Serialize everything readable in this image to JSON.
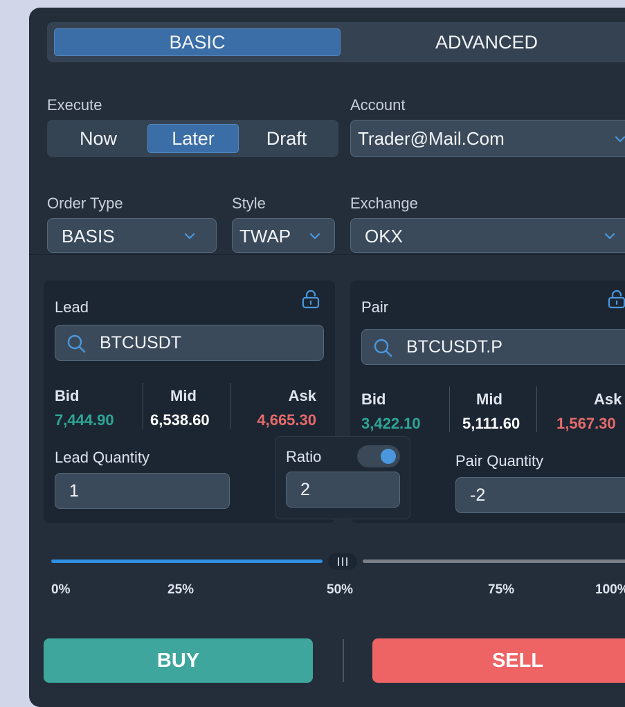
{
  "mode_tabs": {
    "basic": "BASIC",
    "advanced": "ADVANCED",
    "active": "BASIC"
  },
  "execute": {
    "label": "Execute",
    "options": [
      "Now",
      "Later",
      "Draft"
    ],
    "selected": "Later"
  },
  "account": {
    "label": "Account",
    "value": "Trader@Mail.Com"
  },
  "order_type": {
    "label": "Order Type",
    "value": "BASIS"
  },
  "style": {
    "label": "Style",
    "value": "TWAP"
  },
  "exchange": {
    "label": "Exchange",
    "value": "OKX"
  },
  "lead": {
    "title": "Lead",
    "symbol": "BTCUSDT",
    "bid_label": "Bid",
    "mid_label": "Mid",
    "ask_label": "Ask",
    "bid": "7,444.90",
    "mid": "6,538.60",
    "ask": "4,665.30",
    "quantity_label": "Lead Quantity",
    "quantity": "1"
  },
  "pair": {
    "title": "Pair",
    "symbol": "BTCUSDT.P",
    "bid_label": "Bid",
    "mid_label": "Mid",
    "ask_label": "Ask",
    "bid": "3,422.10",
    "mid": "5,111.60",
    "ask": "1,567.30",
    "quantity_label": "Pair Quantity",
    "quantity": "-2"
  },
  "ratio": {
    "label": "Ratio",
    "value": "2",
    "toggle_on": true
  },
  "slider": {
    "value_percent": 50,
    "ticks": [
      "0%",
      "25%",
      "50%",
      "75%",
      "100%"
    ]
  },
  "actions": {
    "buy": "BUY",
    "sell": "SELL"
  },
  "colors": {
    "accent": "#3b6ea6",
    "bid": "#2ea595",
    "ask": "#e66b6b",
    "buy": "#3ea69d",
    "sell": "#ee6464"
  }
}
